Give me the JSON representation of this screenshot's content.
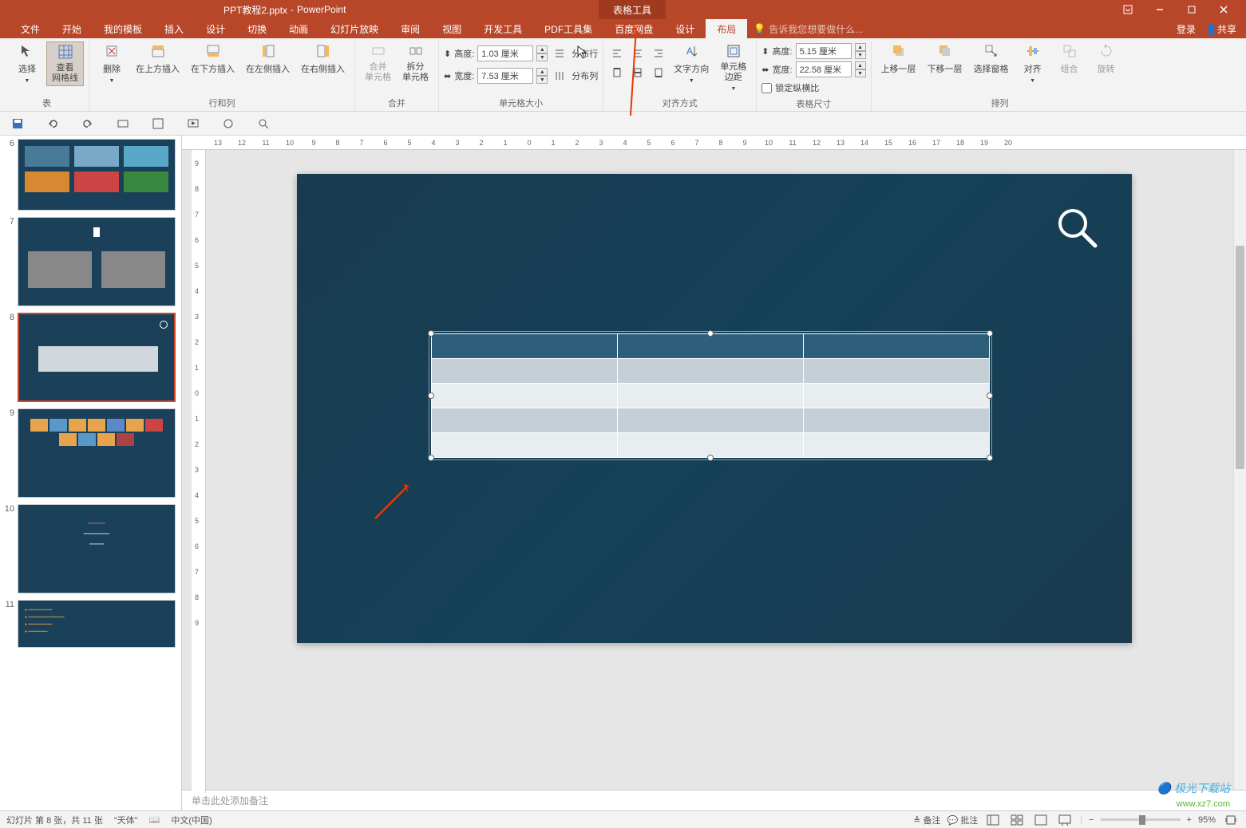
{
  "title": {
    "filename": "PPT教程2.pptx",
    "app": "PowerPoint",
    "contextTab": "表格工具"
  },
  "tabs": {
    "file": "文件",
    "home": "开始",
    "template": "我的模板",
    "insert": "插入",
    "design": "设计",
    "transition": "切换",
    "animation": "动画",
    "slideshow": "幻灯片放映",
    "review": "审阅",
    "view": "视图",
    "developer": "开发工具",
    "pdf": "PDF工具集",
    "baidu": "百度网盘",
    "tbldesign": "设计",
    "layout": "布局",
    "tellme": "告诉我您想要做什么...",
    "login": "登录",
    "share": "共享"
  },
  "ribbon": {
    "select": "选择",
    "viewgrid": "查看\n网格线",
    "delete": "删除",
    "insertAbove": "在上方插入",
    "insertBelow": "在下方插入",
    "insertLeft": "在左侧插入",
    "insertRight": "在右侧插入",
    "mergeCells": "合并\n单元格",
    "splitCells": "拆分\n单元格",
    "heightLabel": "高度:",
    "heightVal": "1.03 厘米",
    "widthLabel": "宽度:",
    "widthVal": "7.53 厘米",
    "distRows": "分布行",
    "distCols": "分布列",
    "textDir": "文字方向",
    "cellMargin": "单元格\n边距",
    "tblHeightLabel": "高度:",
    "tblHeightVal": "5.15 厘米",
    "tblWidthLabel": "宽度:",
    "tblWidthVal": "22.58 厘米",
    "lockAspect": "锁定纵横比",
    "bringFwd": "上移一层",
    "sendBack": "下移一层",
    "selPane": "选择窗格",
    "align": "对齐",
    "group": "组合",
    "rotate": "旋转",
    "groups": {
      "table": "表",
      "rowscols": "行和列",
      "merge": "合并",
      "cellsize": "单元格大小",
      "alignment": "对齐方式",
      "tablesize": "表格尺寸",
      "arrange": "排列"
    }
  },
  "slides": {
    "n6": "6",
    "n7": "7",
    "n8": "8",
    "n9": "9",
    "n10": "10",
    "n11": "11"
  },
  "notes": "单击此处添加备注",
  "status": {
    "slideInfo": "幻灯片 第 8 张，共 11 张",
    "theme": "\"天体\"",
    "lang": "中文(中国)",
    "notesBtn": "备注",
    "commentsBtn": "批注",
    "zoom": "95%"
  },
  "watermark": {
    "brand": "极光下载站",
    "url": "www.xz7.com"
  },
  "ruler": {
    "marks": [
      "13",
      "12",
      "11",
      "10",
      "9",
      "8",
      "7",
      "6",
      "5",
      "4",
      "3",
      "2",
      "1",
      "0",
      "1",
      "2",
      "3",
      "4",
      "5",
      "6",
      "7",
      "8",
      "9",
      "10",
      "11",
      "12",
      "13",
      "14",
      "15",
      "16",
      "17",
      "18",
      "19",
      "20"
    ]
  }
}
